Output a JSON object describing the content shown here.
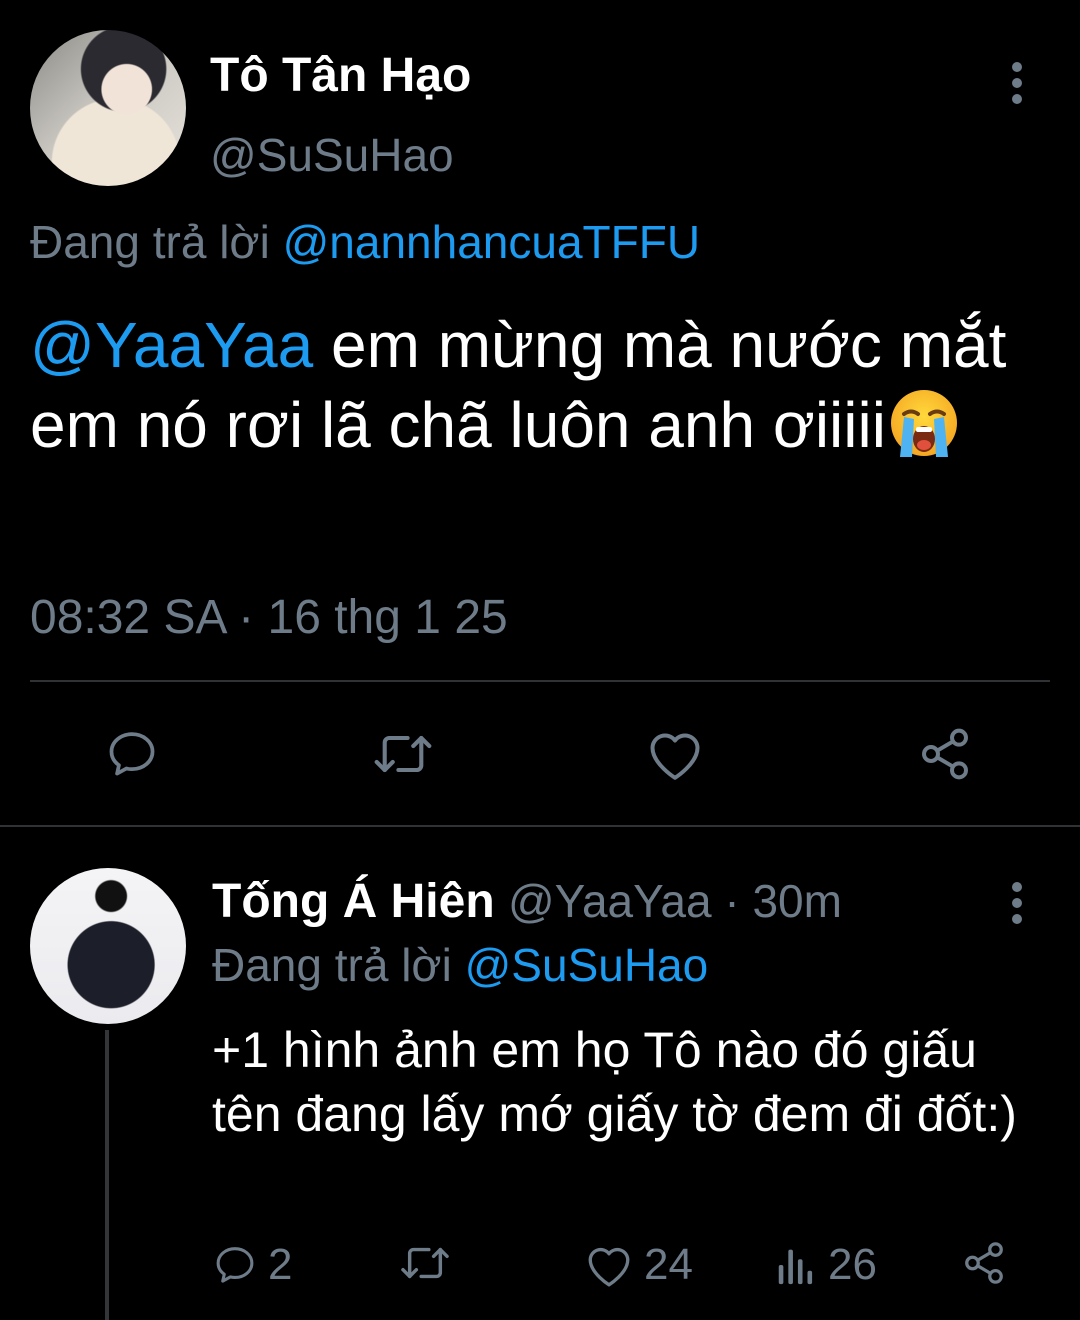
{
  "main_tweet": {
    "author_name": "Tô Tân Hạo",
    "author_handle": "@SuSuHao",
    "replying_prefix": "Đang trả lời",
    "replying_to": "@nannhancuaTFFU",
    "mention": "@YaaYaa",
    "text": " em mừng mà nước mắt em nó rơi lã chã luôn anh ơiiiii",
    "emoji": "loudly-crying-face",
    "timestamp": "08:32 SA · 16 thg 1 25",
    "actions": {
      "reply_icon": "reply-icon",
      "retweet_icon": "retweet-icon",
      "like_icon": "like-icon",
      "share_icon": "share-icon"
    }
  },
  "reply_tweet": {
    "author_name": "Tống Á Hiên",
    "author_handle": "@YaaYaa",
    "separator": " · ",
    "time_ago": "30m",
    "replying_prefix": "Đang trả lời",
    "replying_to": "@SuSuHao",
    "text": "+1 hình ảnh em họ Tô nào đó giấu tên đang lấy mớ giấy tờ đem đi đốt:)",
    "reply_count": "2",
    "retweet_count": "",
    "like_count": "24",
    "view_count": "26"
  },
  "colors": {
    "background": "#000000",
    "text": "#ffffff",
    "muted": "#6e7b88",
    "link": "#1d9bf0",
    "divider": "#2f3336"
  }
}
